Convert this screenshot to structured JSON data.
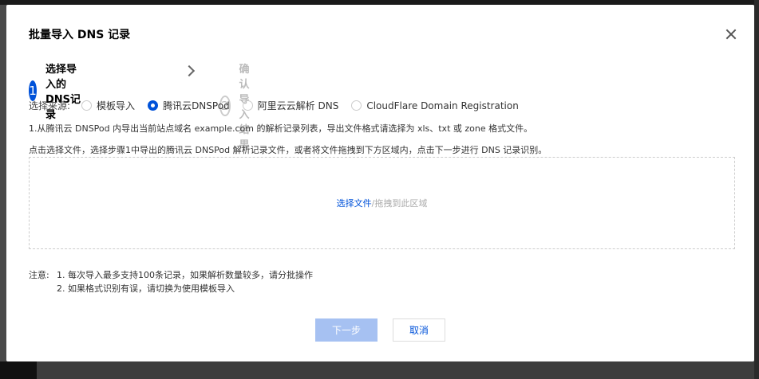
{
  "dialog": {
    "title": "批量导入 DNS 记录",
    "close_icon": "close-icon"
  },
  "steps": [
    {
      "number": "1",
      "label": "选择导入的DNS记录",
      "state": "active"
    },
    {
      "number": "2",
      "label": "确认导入结果",
      "state": "pending"
    }
  ],
  "source": {
    "label": "选择来源:",
    "options": [
      {
        "label": "模板导入",
        "checked": false
      },
      {
        "label": "腾讯云DNSPod",
        "checked": true
      },
      {
        "label": "阿里云云解析 DNS",
        "checked": false
      },
      {
        "label": "CloudFlare Domain Registration",
        "checked": false
      }
    ]
  },
  "instructions": {
    "line1": "1.从腾讯云 DNSPod 内导出当前站点域名 example.com 的解析记录列表，导出文件格式请选择为 xls、txt 或 zone 格式文件。",
    "line2": "点击选择文件，选择步骤1中导出的腾讯云 DNSPod 解析记录文件，或者将文件拖拽到下方区域内，点击下一步进行 DNS 记录识别。"
  },
  "dropzone": {
    "pick_label": "选择文件",
    "drag_label": "/拖拽到此区域"
  },
  "notes": {
    "prefix": "注意:",
    "items": [
      "1. 每次导入最多支持100条记录，如果解析数量较多，请分批操作",
      "2. 如果格式识别有误，请切换为使用模板导入"
    ]
  },
  "buttons": {
    "next": "下一步",
    "cancel": "取消"
  },
  "colors": {
    "accent": "#0052d9",
    "disabled_button": "#a6c1f2"
  }
}
